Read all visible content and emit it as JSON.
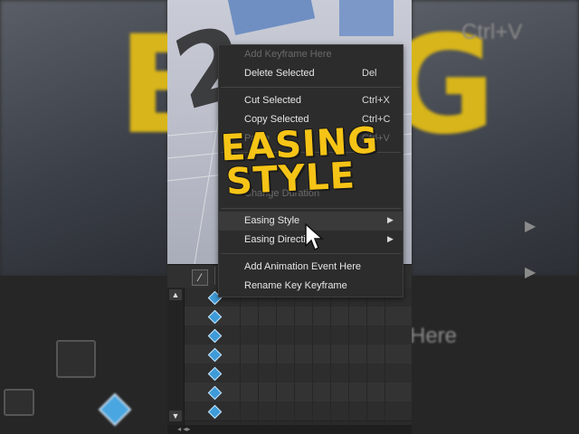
{
  "menu": {
    "items": [
      {
        "label": "Add Keyframe Here",
        "shortcut": "",
        "disabled": true,
        "submenu": false
      },
      {
        "label": "Delete Selected",
        "shortcut": "Del",
        "disabled": false,
        "submenu": false
      },
      {
        "label": "Cut Selected",
        "shortcut": "Ctrl+X",
        "disabled": false,
        "submenu": false
      },
      {
        "label": "Copy Selected",
        "shortcut": "Ctrl+C",
        "disabled": false,
        "submenu": false
      },
      {
        "label": "Paste",
        "shortcut": "Ctrl+V",
        "disabled": true,
        "submenu": false
      },
      {
        "label": "Change Duration",
        "shortcut": "",
        "disabled": true,
        "submenu": false
      },
      {
        "label": "Easing Style",
        "shortcut": "",
        "disabled": false,
        "submenu": true
      },
      {
        "label": "Easing Direction",
        "shortcut": "",
        "disabled": false,
        "submenu": true
      },
      {
        "label": "Add Animation Event Here",
        "shortcut": "",
        "disabled": false,
        "submenu": false
      },
      {
        "label": "Rename Key Keyframe",
        "shortcut": "",
        "disabled": false,
        "submenu": false
      }
    ]
  },
  "overlay": {
    "line1": "EASING",
    "line2": "STYLE"
  },
  "side_ghost": {
    "right_shortcut": "Ctrl+V",
    "right_here": "Here"
  },
  "colors": {
    "overlay_yellow": "#f6c416",
    "keyframe_blue": "#3e9bd8",
    "menu_bg": "#2c2c2c"
  },
  "icons": {
    "curve": "curve-editor-icon",
    "cursor": "mouse-pointer-icon",
    "submenu": "chevron-right-icon"
  }
}
